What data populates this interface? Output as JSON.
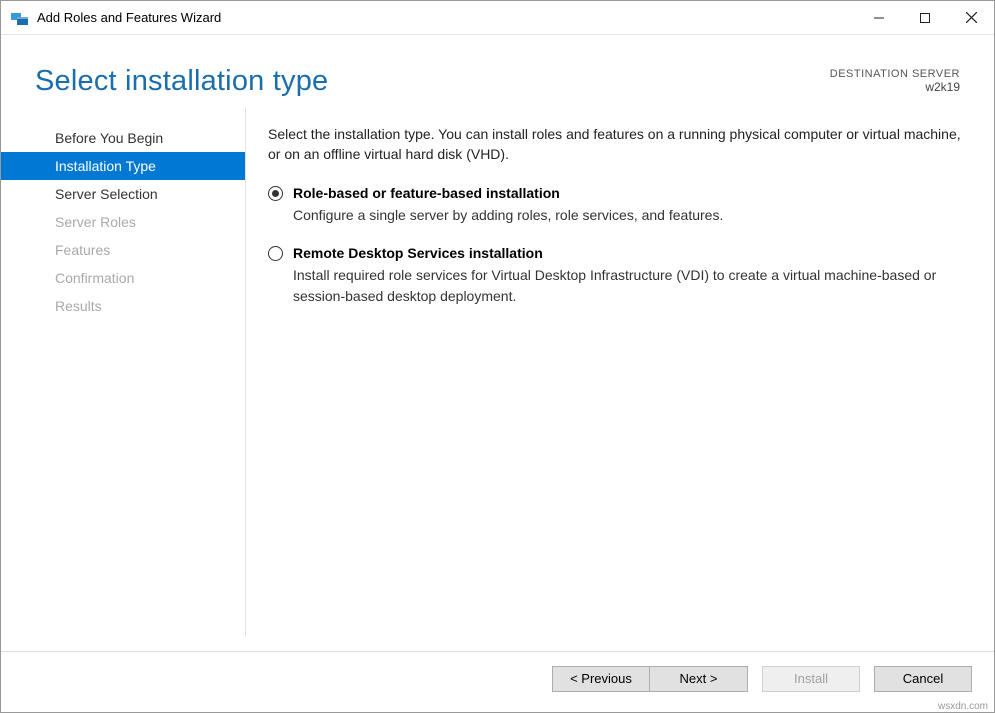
{
  "window": {
    "title": "Add Roles and Features Wizard"
  },
  "page": {
    "heading": "Select installation type",
    "destination_label": "DESTINATION SERVER",
    "destination_value": "w2k19"
  },
  "steps": [
    {
      "label": "Before You Begin",
      "state": "enabled"
    },
    {
      "label": "Installation Type",
      "state": "active"
    },
    {
      "label": "Server Selection",
      "state": "enabled"
    },
    {
      "label": "Server Roles",
      "state": "disabled"
    },
    {
      "label": "Features",
      "state": "disabled"
    },
    {
      "label": "Confirmation",
      "state": "disabled"
    },
    {
      "label": "Results",
      "state": "disabled"
    }
  ],
  "content": {
    "intro": "Select the installation type. You can install roles and features on a running physical computer or virtual machine, or on an offline virtual hard disk (VHD).",
    "options": [
      {
        "title": "Role-based or feature-based installation",
        "desc": "Configure a single server by adding roles, role services, and features.",
        "selected": true
      },
      {
        "title": "Remote Desktop Services installation",
        "desc": "Install required role services for Virtual Desktop Infrastructure (VDI) to create a virtual machine-based or session-based desktop deployment.",
        "selected": false
      }
    ]
  },
  "buttons": {
    "previous": "< Previous",
    "next": "Next >",
    "install": "Install",
    "cancel": "Cancel"
  },
  "watermark": "wsxdn.com"
}
